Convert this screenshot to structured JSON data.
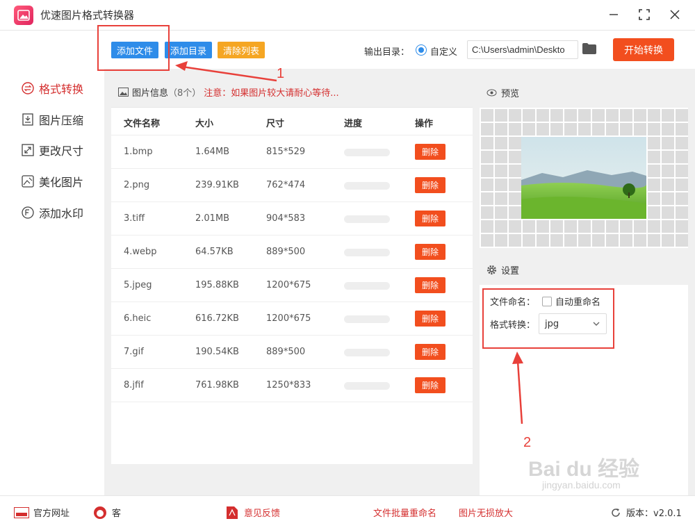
{
  "app": {
    "title": "优速图片格式转换器"
  },
  "toolbar": {
    "add_file": "添加文件",
    "add_dir": "添加目录",
    "clear_list": "清除列表",
    "output_label": "输出目录：",
    "custom_label": "自定义",
    "output_path": "C:\\Users\\admin\\Deskto",
    "start_label": "开始转换"
  },
  "nav": [
    {
      "label": "格式转换",
      "icon": "swap-icon"
    },
    {
      "label": "图片压缩",
      "icon": "compress-icon"
    },
    {
      "label": "更改尺寸",
      "icon": "resize-icon"
    },
    {
      "label": "美化图片",
      "icon": "beautify-icon"
    },
    {
      "label": "添加水印",
      "icon": "watermark-icon"
    }
  ],
  "list": {
    "title": "图片信息",
    "count": "（8个）",
    "warning": "注意：如果图片较大请耐心等待...",
    "columns": {
      "name": "文件名称",
      "size": "大小",
      "dimensions": "尺寸",
      "progress": "进度",
      "action": "操作"
    },
    "delete_label": "删除",
    "rows": [
      {
        "name": "1.bmp",
        "size": "1.64MB",
        "dim": "815*529",
        "progress": 0
      },
      {
        "name": "2.png",
        "size": "239.91KB",
        "dim": "762*474",
        "progress": 0
      },
      {
        "name": "3.tiff",
        "size": "2.01MB",
        "dim": "904*583",
        "progress": 0
      },
      {
        "name": "4.webp",
        "size": "64.57KB",
        "dim": "889*500",
        "progress": 0
      },
      {
        "name": "5.jpeg",
        "size": "195.88KB",
        "dim": "1200*675",
        "progress": 0
      },
      {
        "name": "6.heic",
        "size": "616.72KB",
        "dim": "1200*675",
        "progress": 0
      },
      {
        "name": "7.gif",
        "size": "190.54KB",
        "dim": "889*500",
        "progress": 0
      },
      {
        "name": "8.jfif",
        "size": "761.98KB",
        "dim": "1250*833",
        "progress": 0
      }
    ]
  },
  "preview": {
    "title": "预览"
  },
  "settings": {
    "title": "设置",
    "naming_label": "文件命名：",
    "auto_rename": "自动重命名",
    "format_label": "格式转换：",
    "format_value": "jpg"
  },
  "annotations": {
    "one": "1",
    "two": "2"
  },
  "watermark": {
    "text": "Bai du 经验",
    "sub": "jingyan.baidu.com"
  },
  "footer": {
    "website": "官方网址",
    "service": "客",
    "feedback": "意见反馈",
    "batch_rename": "文件批量重命名",
    "lossless": "图片无损放大",
    "version": "版本：v2.0.1"
  },
  "colors": {
    "accent_red": "#f24e1e",
    "accent_blue": "#2e8ce9",
    "nav_active": "#d42e2e",
    "annotation": "#e8403a"
  }
}
